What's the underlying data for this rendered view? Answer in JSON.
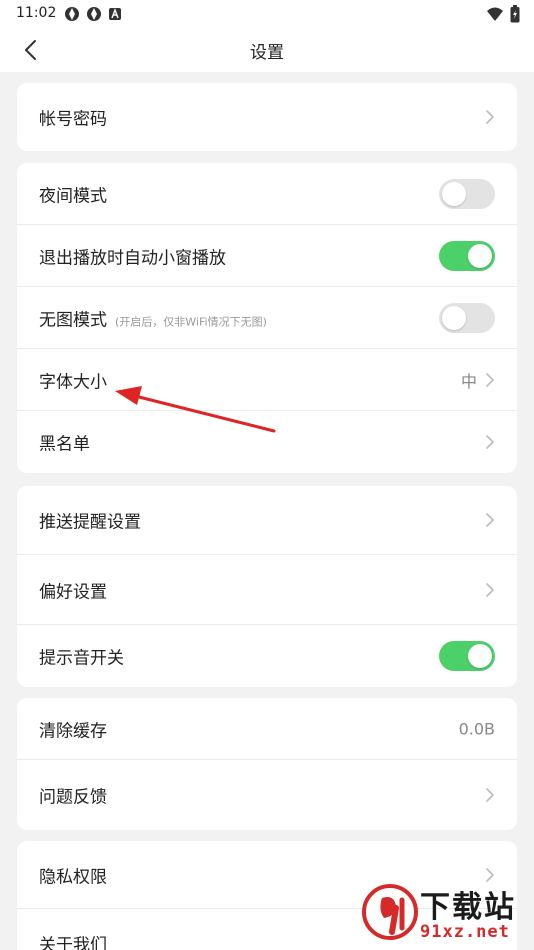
{
  "status_bar": {
    "time": "11:02"
  },
  "nav": {
    "title": "设置"
  },
  "sections": {
    "account": {
      "label": "帐号密码"
    },
    "display": {
      "night_mode": {
        "label": "夜间模式",
        "on": false
      },
      "pip_on_exit": {
        "label": "退出播放时自动小窗播放",
        "on": true
      },
      "no_image": {
        "label": "无图模式",
        "hint": "(开启后，仅非WiFi情况下无图)",
        "on": false
      },
      "font_size": {
        "label": "字体大小",
        "value": "中"
      },
      "blacklist": {
        "label": "黑名单"
      }
    },
    "notify": {
      "push": {
        "label": "推送提醒设置"
      },
      "preference": {
        "label": "偏好设置"
      },
      "sound": {
        "label": "提示音开关",
        "on": true
      }
    },
    "storage": {
      "clear_cache": {
        "label": "清除缓存",
        "value": "0.0B"
      },
      "feedback": {
        "label": "问题反馈"
      }
    },
    "about": {
      "privacy": {
        "label": "隐私权限"
      },
      "about_us": {
        "label": "关于我们"
      }
    }
  },
  "colors": {
    "toggle_on": "#4cd06a",
    "toggle_off": "#e3e3e3",
    "annotation": "#e02424"
  },
  "watermark": {
    "top": "下载站",
    "bottom": "91xz.net"
  }
}
